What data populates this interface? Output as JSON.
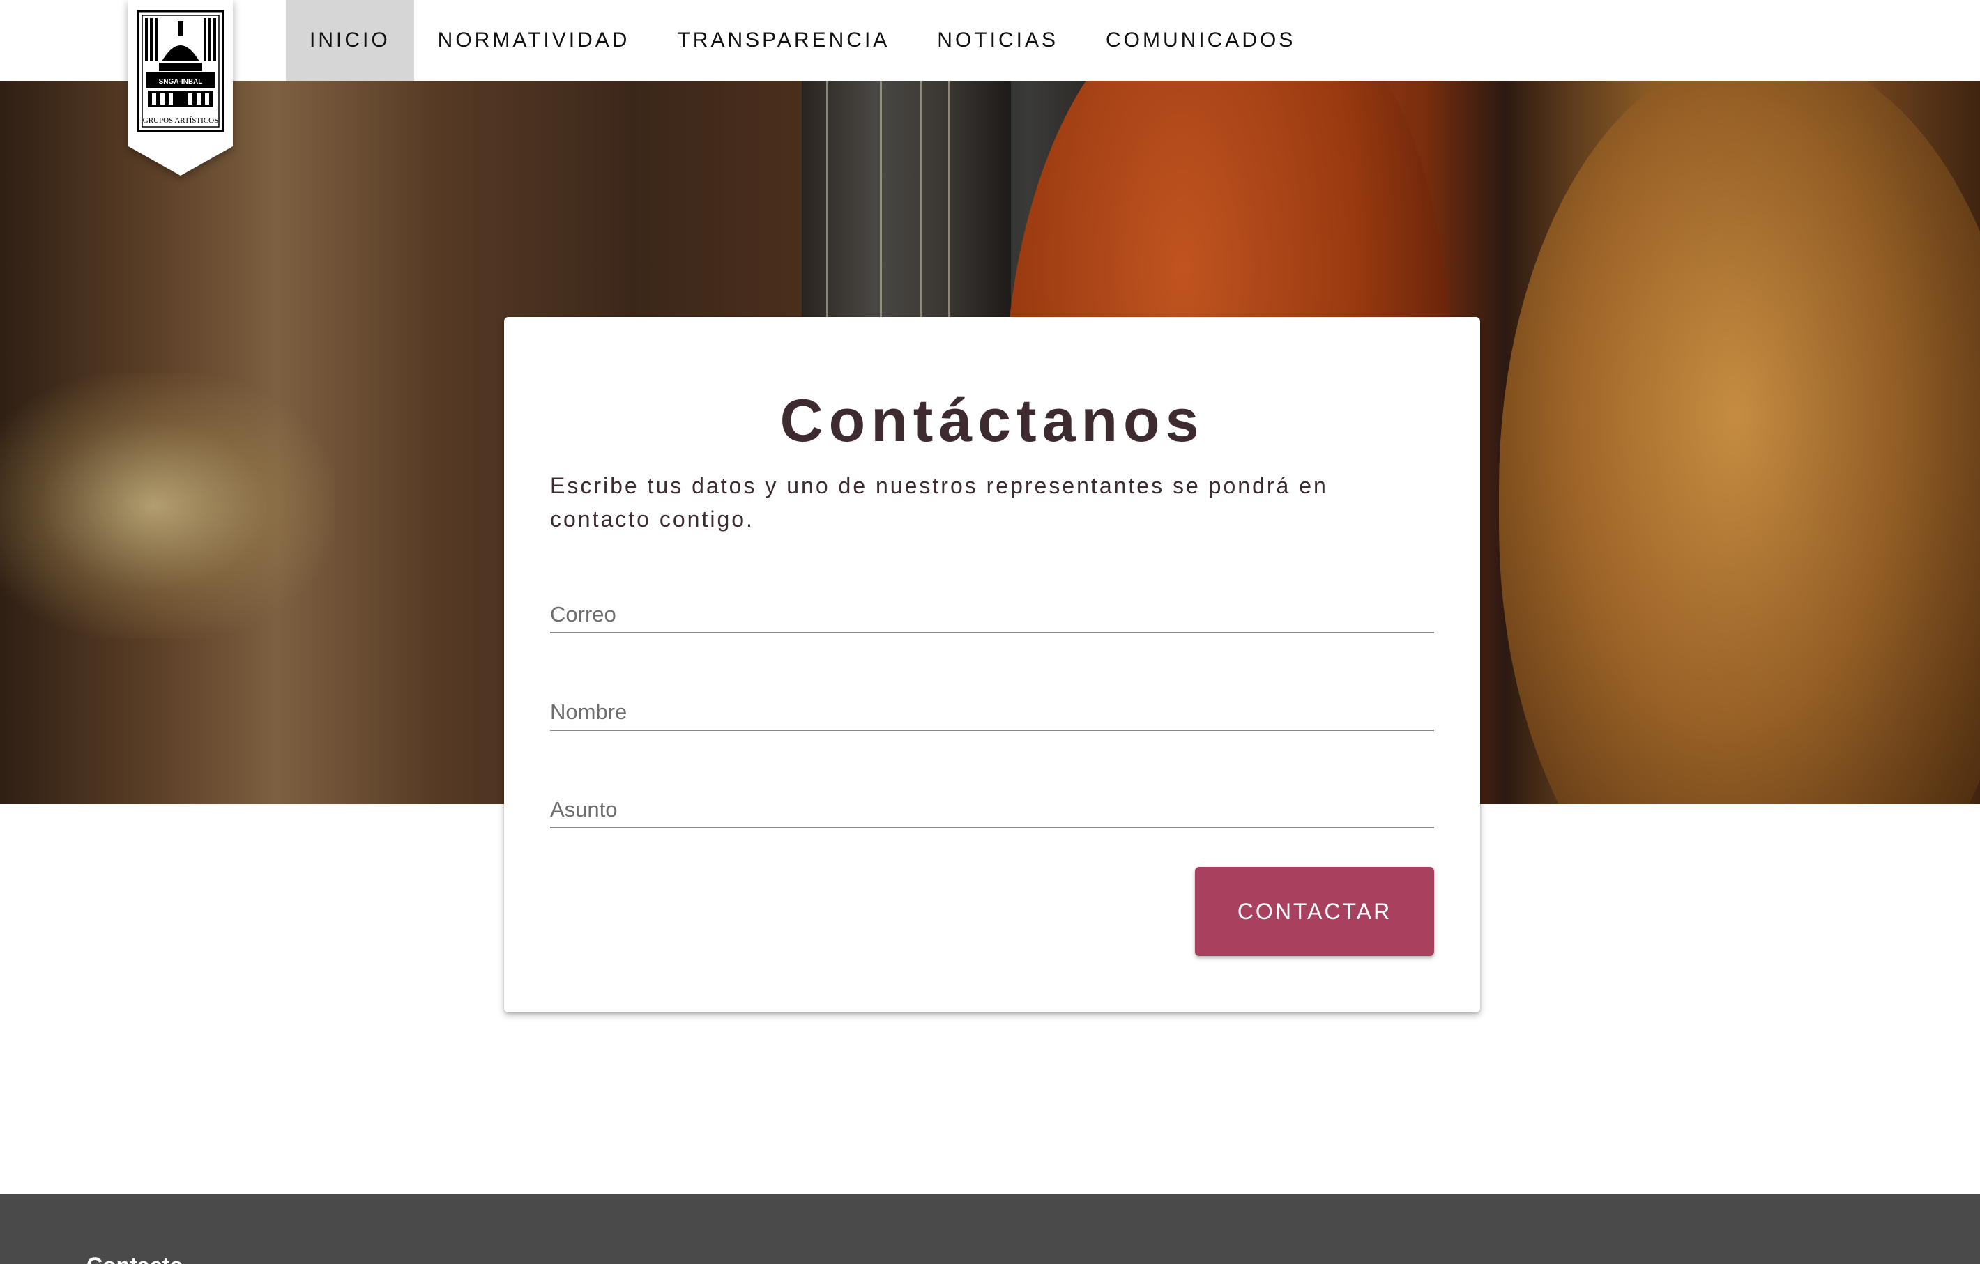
{
  "nav": {
    "items": [
      {
        "label": "INICIO",
        "active": true
      },
      {
        "label": "NORMATIVIDAD",
        "active": false
      },
      {
        "label": "TRANSPARENCIA",
        "active": false
      },
      {
        "label": "NOTICIAS",
        "active": false
      },
      {
        "label": "COMUNICADOS",
        "active": false
      }
    ]
  },
  "logo": {
    "text_top": "SNGA-INBAL",
    "text_bottom": "GRUPOS ARTÍSTICOS"
  },
  "contact": {
    "title": "Contáctanos",
    "description": "Escribe tus datos y uno de nuestros representantes se pondrá en contacto contigo.",
    "fields": {
      "email_placeholder": "Correo",
      "name_placeholder": "Nombre",
      "subject_placeholder": "Asunto"
    },
    "submit_label": "CONTACTAR"
  },
  "footer": {
    "title": "Contacto"
  },
  "colors": {
    "accent": "#a8415e",
    "title_text": "#3d2b2f",
    "footer_bg": "#4a4a4a",
    "nav_active_bg": "#d6d6d6"
  }
}
